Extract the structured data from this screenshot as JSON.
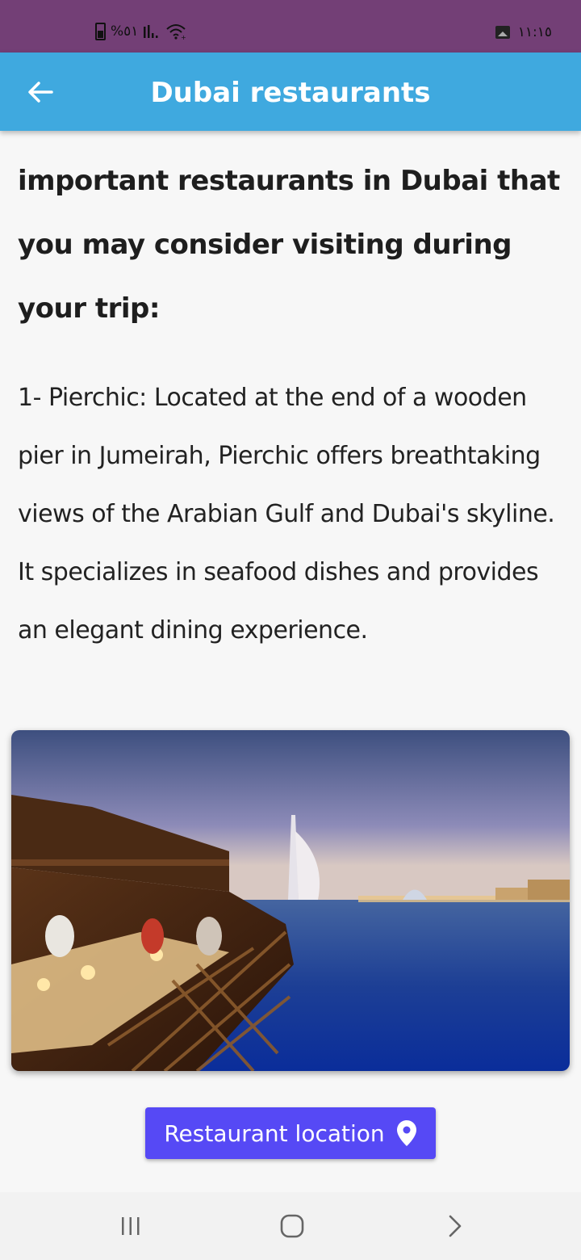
{
  "status_bar": {
    "battery": "%٥١",
    "time": "١١:١٥"
  },
  "app_bar": {
    "title": "Dubai restaurants",
    "back_icon": "arrow-left-icon"
  },
  "content": {
    "heading": "important restaurants in Dubai that you may consider visiting during your trip:",
    "body": "1- Pierchic: Located at the end of a wooden pier in Jumeirah, Pierchic offers breathtaking views of the Arabian Gulf and Dubai's skyline. It specializes in seafood dishes and provides an elegant dining experience."
  },
  "location_button": {
    "label": "Restaurant location",
    "icon": "map-pin-icon",
    "color": "#5649f5"
  },
  "colors": {
    "status_bar": "#733f76",
    "app_bar": "#3fa9df",
    "background": "#f7f7f7"
  },
  "nav_bar": {
    "recents_icon": "recents-icon",
    "home_icon": "home-icon",
    "back_icon": "chevron-right-icon"
  }
}
